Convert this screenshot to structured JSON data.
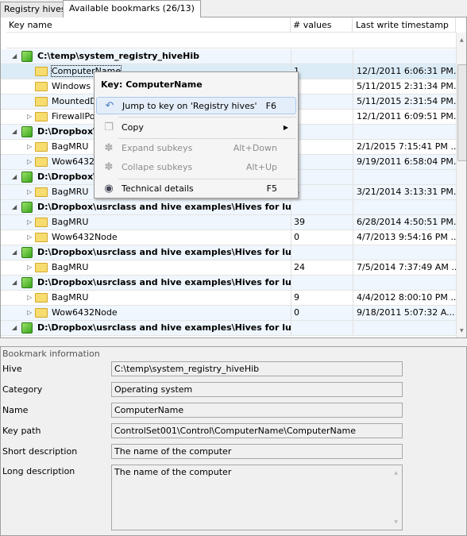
{
  "tabs": [
    "Registry hives",
    "Available bookmarks (26/13)"
  ],
  "columns": [
    "Key name",
    "# values",
    "Last write timestamp"
  ],
  "rows": [
    {
      "level": 0,
      "name": "C:\\temp\\system_registry_hiveHib",
      "values": "",
      "ts": "",
      "exp": "open"
    },
    {
      "level": 1,
      "name": "ComputerName",
      "values": "1",
      "ts": "12/1/2011 6:06:31 PM...",
      "exp": "",
      "selected": true
    },
    {
      "level": 1,
      "name": "Windows",
      "values": "",
      "ts": "5/11/2015 2:31:34 PM...",
      "exp": ""
    },
    {
      "level": 1,
      "name": "MountedDevices",
      "values": "",
      "ts": "5/11/2015 2:31:54 PM...",
      "exp": ""
    },
    {
      "level": 1,
      "name": "FirewallPolicy",
      "values": "",
      "ts": "12/1/2011 6:09:51 PM...",
      "exp": "closed"
    },
    {
      "level": 0,
      "name": "D:\\Dropbox\\usrclass and hive examples\\Hives for lun...",
      "values": "",
      "ts": "",
      "exp": "open"
    },
    {
      "level": 1,
      "name": "BagMRU",
      "values": "",
      "ts": "2/1/2015 7:15:41 PM ...",
      "exp": "closed"
    },
    {
      "level": 1,
      "name": "Wow6432Node",
      "values": "",
      "ts": "9/19/2011 6:58:04 PM...",
      "exp": "closed"
    },
    {
      "level": 0,
      "name": "D:\\Dropbox\\usrclass and hive examples\\Hives for lun...",
      "values": "",
      "ts": "",
      "exp": "open"
    },
    {
      "level": 1,
      "name": "BagMRU",
      "values": "4",
      "ts": "3/21/2014 3:13:31 PM...",
      "exp": "closed"
    },
    {
      "level": 0,
      "name": "D:\\Dropbox\\usrclass and hive examples\\Hives for lun...",
      "values": "",
      "ts": "",
      "exp": "open"
    },
    {
      "level": 1,
      "name": "BagMRU",
      "values": "39",
      "ts": "6/28/2014 4:50:51 PM...",
      "exp": "closed"
    },
    {
      "level": 1,
      "name": "Wow6432Node",
      "values": "0",
      "ts": "4/7/2013 9:54:16 PM ...",
      "exp": "closed"
    },
    {
      "level": 0,
      "name": "D:\\Dropbox\\usrclass and hive examples\\Hives for lun...",
      "values": "",
      "ts": "",
      "exp": "open"
    },
    {
      "level": 1,
      "name": "BagMRU",
      "values": "24",
      "ts": "7/5/2014 7:37:49 AM ...",
      "exp": "closed"
    },
    {
      "level": 0,
      "name": "D:\\Dropbox\\usrclass and hive examples\\Hives for lun...",
      "values": "",
      "ts": "",
      "exp": "open"
    },
    {
      "level": 1,
      "name": "BagMRU",
      "values": "9",
      "ts": "4/4/2012 8:00:10 PM ...",
      "exp": "closed"
    },
    {
      "level": 1,
      "name": "Wow6432Node",
      "values": "0",
      "ts": "9/18/2011 5:07:32 A...",
      "exp": "closed"
    },
    {
      "level": 0,
      "name": "D:\\Dropbox\\usrclass and hive examples\\Hives for lun...",
      "values": "",
      "ts": "",
      "exp": "open"
    }
  ],
  "menu": {
    "title": "Key: ComputerName",
    "items": [
      {
        "label": "Jump to key on 'Registry hives'",
        "shortcut": "F6",
        "icon": "jump-back-arrow-icon"
      },
      {
        "label": "Copy",
        "shortcut": "",
        "icon": "copy-icon"
      },
      {
        "label": "Expand subkeys",
        "shortcut": "Alt+Down",
        "icon": "expand-icon"
      },
      {
        "label": "Collape subkeys",
        "shortcut": "Alt+Up",
        "icon": "collapse-icon"
      },
      {
        "label": "Technical details",
        "shortcut": "F5",
        "icon": "eye-icon"
      }
    ]
  },
  "info": {
    "title": "Bookmark information",
    "fields": [
      {
        "label": "Hive",
        "value": "C:\\temp\\system_registry_hiveHib"
      },
      {
        "label": "Category",
        "value": "Operating system"
      },
      {
        "label": "Name",
        "value": "ComputerName"
      },
      {
        "label": "Key path",
        "value": "ControlSet001\\Control\\ComputerName\\ComputerName"
      },
      {
        "label": "Short description",
        "value": "The name of the computer"
      },
      {
        "label": "Long description",
        "value": "The name of the computer"
      }
    ]
  }
}
